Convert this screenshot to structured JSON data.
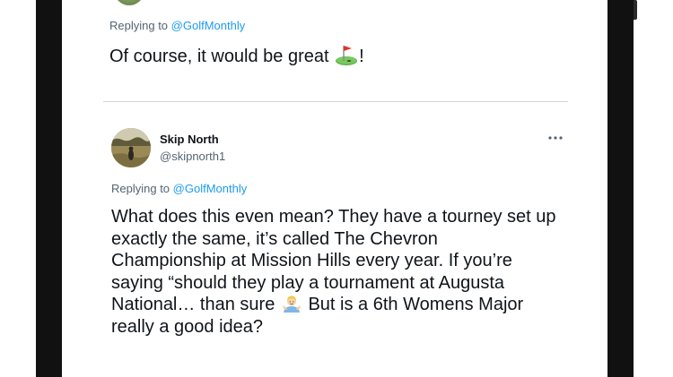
{
  "previous_tweet": {
    "replying_prefix": "Replying to",
    "replying_handle": "@GolfMonthly",
    "text_before_emoji": "Of course, it would be great",
    "emoji_icon": "golf-flag-emoji",
    "text_after_emoji": "!"
  },
  "tweet": {
    "display_name": "Skip North",
    "username": "@skipnorth1",
    "more_icon": "more-horizontal-icon",
    "replying_prefix": "Replying to",
    "replying_handle": "@GolfMonthly",
    "lines": [
      "What does this even mean? They have a tourney set up",
      "exactly the same, it’s called The Chevron",
      "Championship at Mission Hills every year. If you’re",
      "saying “should they play a tournament at Augusta"
    ],
    "line5_before_emoji": "National… than sure",
    "line5_emoji_icon": "person-shrugging-emoji",
    "line5_after_emoji": "But is a 6th Womens Major",
    "line6": "really a good idea?"
  },
  "colors": {
    "link": "#1d9bf0",
    "secondary_text": "#536471",
    "primary_text": "#0f1419",
    "divider": "#cfd9de",
    "bezel": "#111111"
  }
}
